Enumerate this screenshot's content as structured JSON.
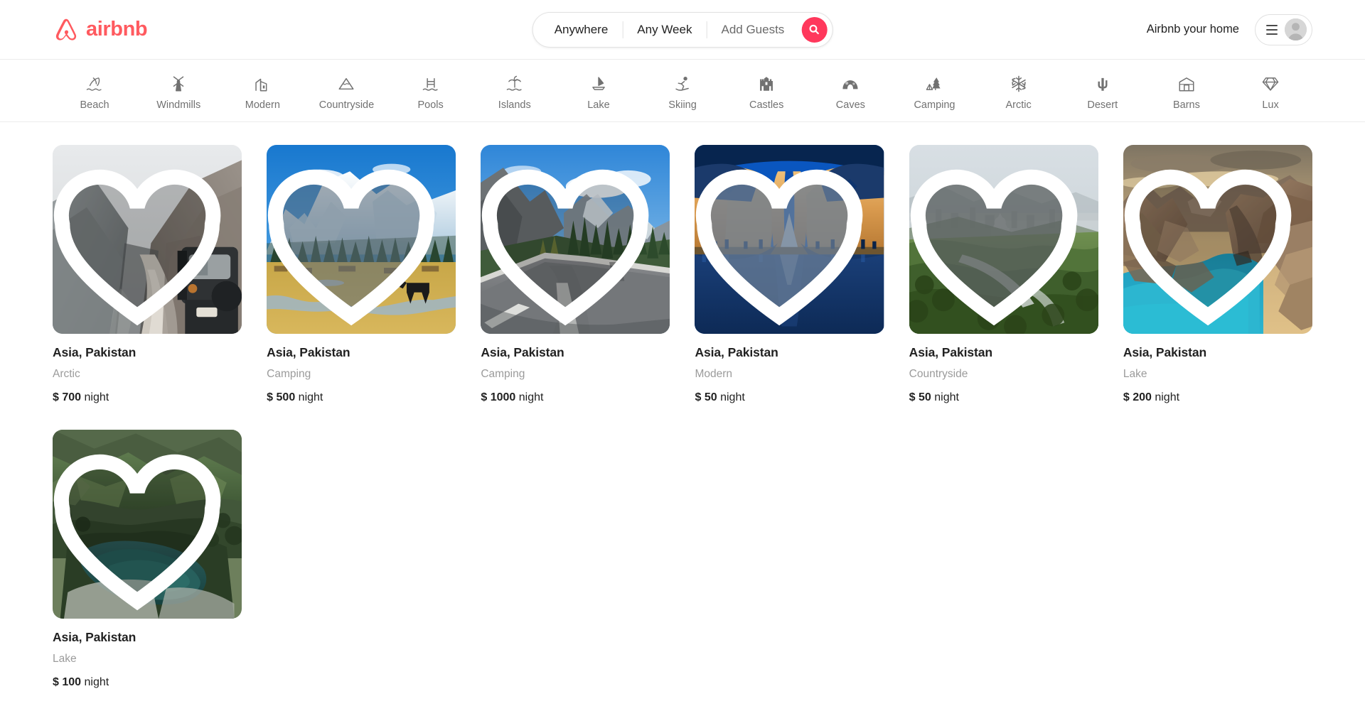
{
  "theme": {
    "brand_color": "#FF5A5F",
    "text_primary": "#222222",
    "text_muted": "#717171",
    "text_light": "#9B9B9B"
  },
  "header": {
    "logo_icon": "airbnb-belo-icon",
    "logo_text": "airbnb",
    "search": {
      "where_label": "Anywhere",
      "when_label": "Any Week",
      "guests_placeholder": "Add Guests",
      "search_icon": "search-icon"
    },
    "host_link": "Airbnb your home",
    "menu_icon": "hamburger-menu-icon",
    "avatar_icon": "user-avatar-icon"
  },
  "categories": [
    {
      "label": "Beach",
      "icon": "beach-umbrella-icon"
    },
    {
      "label": "Windmills",
      "icon": "windmill-icon"
    },
    {
      "label": "Modern",
      "icon": "modern-building-icon"
    },
    {
      "label": "Countryside",
      "icon": "mountain-icon"
    },
    {
      "label": "Pools",
      "icon": "pool-icon"
    },
    {
      "label": "Islands",
      "icon": "island-palm-icon"
    },
    {
      "label": "Lake",
      "icon": "lake-boat-icon"
    },
    {
      "label": "Skiing",
      "icon": "skier-icon"
    },
    {
      "label": "Castles",
      "icon": "castle-icon"
    },
    {
      "label": "Caves",
      "icon": "cave-icon"
    },
    {
      "label": "Camping",
      "icon": "camping-tent-tree-icon"
    },
    {
      "label": "Arctic",
      "icon": "snowflake-icon"
    },
    {
      "label": "Desert",
      "icon": "cactus-icon"
    },
    {
      "label": "Barns",
      "icon": "barn-icon"
    },
    {
      "label": "Lux",
      "icon": "diamond-icon"
    }
  ],
  "listings": [
    {
      "title": "Asia, Pakistan",
      "category": "Arctic",
      "currency": "$",
      "price": "700",
      "unit": "night",
      "favorite_icon": "heart-icon",
      "favorited": false,
      "image_alt": "mountain-road-jeep-photo"
    },
    {
      "title": "Asia, Pakistan",
      "category": "Camping",
      "currency": "$",
      "price": "500",
      "unit": "night",
      "favorite_icon": "heart-icon",
      "favorited": false,
      "image_alt": "snow-peak-meadow-horse-photo"
    },
    {
      "title": "Asia, Pakistan",
      "category": "Camping",
      "currency": "$",
      "price": "1000",
      "unit": "night",
      "favorite_icon": "heart-icon",
      "favorited": false,
      "image_alt": "mountain-highway-autumn-photo"
    },
    {
      "title": "Asia, Pakistan",
      "category": "Modern",
      "currency": "$",
      "price": "50",
      "unit": "night",
      "favorite_icon": "heart-icon",
      "favorited": false,
      "image_alt": "pakistan-monument-night-photo"
    },
    {
      "title": "Asia, Pakistan",
      "category": "Countryside",
      "currency": "$",
      "price": "50",
      "unit": "night",
      "favorite_icon": "heart-icon",
      "favorited": false,
      "image_alt": "green-hills-city-view-photo"
    },
    {
      "title": "Asia, Pakistan",
      "category": "Lake",
      "currency": "$",
      "price": "200",
      "unit": "night",
      "favorite_icon": "heart-icon",
      "favorited": false,
      "image_alt": "attabad-turquoise-lake-photo"
    },
    {
      "title": "Asia, Pakistan",
      "category": "Lake",
      "currency": "$",
      "price": "100",
      "unit": "night",
      "favorite_icon": "heart-icon",
      "favorited": false,
      "image_alt": "alpine-lake-valley-photo"
    }
  ]
}
